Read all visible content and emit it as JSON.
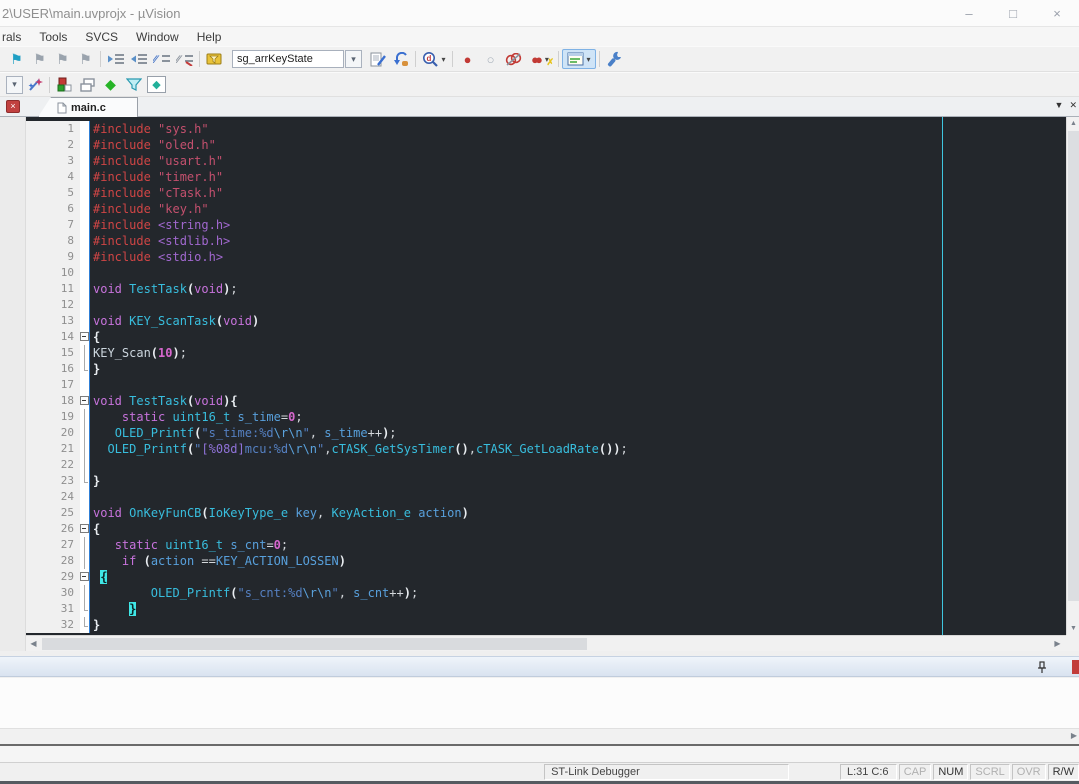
{
  "window": {
    "title": "2\\USER\\main.uvprojx - µVision",
    "minimize": "–",
    "maximize": "□",
    "close": "×"
  },
  "menu": {
    "items": [
      "rals",
      "Tools",
      "SVCS",
      "Window",
      "Help"
    ]
  },
  "toolbar_main": {
    "symbol_combo_value": "sg_arrKeyState",
    "icons": [
      "insert-bookmark",
      "previous-bookmark",
      "next-bookmark",
      "clear-all-bookmarks",
      "unindent",
      "indent",
      "comment-selection",
      "uncomment-selection",
      "find-in-files",
      "symbol-combo",
      "configure-flash-tools",
      "jump-back",
      "find-dialog",
      "toggle-breakpoint",
      "disable-breakpoint",
      "disable-all-breakpoints",
      "kill-all-breakpoints",
      "debug-windows",
      "configure-tools"
    ]
  },
  "toolbar_debug": {
    "icons": [
      "window-select-dropdown",
      "wizard",
      "command-window",
      "disassembly-window",
      "symbols-window",
      "watch-window",
      "memory-window"
    ]
  },
  "tabs": {
    "active": "main.c"
  },
  "editor": {
    "language": "c",
    "lines": [
      {
        "n": "1",
        "fold": "none",
        "t": [
          [
            "pp",
            "#include"
          ],
          [
            "pl",
            " "
          ],
          [
            "inc",
            "\"sys.h\""
          ]
        ]
      },
      {
        "n": "2",
        "fold": "none",
        "t": [
          [
            "pp",
            "#include"
          ],
          [
            "pl",
            " "
          ],
          [
            "inc",
            "\"oled.h\""
          ]
        ]
      },
      {
        "n": "3",
        "fold": "none",
        "t": [
          [
            "pp",
            "#include"
          ],
          [
            "pl",
            " "
          ],
          [
            "inc",
            "\"usart.h\""
          ]
        ]
      },
      {
        "n": "4",
        "fold": "none",
        "t": [
          [
            "pp",
            "#include"
          ],
          [
            "pl",
            " "
          ],
          [
            "inc",
            "\"timer.h\""
          ]
        ]
      },
      {
        "n": "5",
        "fold": "none",
        "t": [
          [
            "pp",
            "#include"
          ],
          [
            "pl",
            " "
          ],
          [
            "inc",
            "\"cTask.h\""
          ]
        ]
      },
      {
        "n": "6",
        "fold": "none",
        "t": [
          [
            "pp",
            "#include"
          ],
          [
            "pl",
            " "
          ],
          [
            "inc",
            "\"key.h\""
          ]
        ]
      },
      {
        "n": "7",
        "fold": "none",
        "t": [
          [
            "pp",
            "#include"
          ],
          [
            "pl",
            " "
          ],
          [
            "incs",
            "<string.h>"
          ]
        ]
      },
      {
        "n": "8",
        "fold": "none",
        "t": [
          [
            "pp",
            "#include"
          ],
          [
            "pl",
            " "
          ],
          [
            "incs",
            "<stdlib.h>"
          ]
        ]
      },
      {
        "n": "9",
        "fold": "none",
        "t": [
          [
            "pp",
            "#include"
          ],
          [
            "pl",
            " "
          ],
          [
            "incs",
            "<stdio.h>"
          ]
        ]
      },
      {
        "n": "10",
        "fold": "none",
        "t": []
      },
      {
        "n": "11",
        "fold": "none",
        "t": [
          [
            "kw",
            "void"
          ],
          [
            "pl",
            " "
          ],
          [
            "cy",
            "TestTask"
          ],
          [
            "br",
            "("
          ],
          [
            "kw",
            "void"
          ],
          [
            "br",
            ")"
          ],
          [
            "pun",
            ";"
          ]
        ]
      },
      {
        "n": "12",
        "fold": "none",
        "t": []
      },
      {
        "n": "13",
        "fold": "none",
        "t": [
          [
            "kw",
            "void"
          ],
          [
            "pl",
            " "
          ],
          [
            "cy",
            "KEY_ScanTask"
          ],
          [
            "br",
            "("
          ],
          [
            "kw",
            "void"
          ],
          [
            "br",
            ")"
          ]
        ]
      },
      {
        "n": "14",
        "fold": "box",
        "t": [
          [
            "br",
            "{"
          ]
        ]
      },
      {
        "n": "15",
        "fold": "line",
        "t": [
          [
            "pl2",
            "KEY_Scan"
          ],
          [
            "br",
            "("
          ],
          [
            "num",
            "10"
          ],
          [
            "br",
            ")"
          ],
          [
            "pun",
            ";"
          ]
        ]
      },
      {
        "n": "16",
        "fold": "end",
        "t": [
          [
            "br",
            "}"
          ]
        ]
      },
      {
        "n": "17",
        "fold": "none",
        "t": []
      },
      {
        "n": "18",
        "fold": "box",
        "t": [
          [
            "kw",
            "void"
          ],
          [
            "pl",
            " "
          ],
          [
            "cy",
            "TestTask"
          ],
          [
            "br",
            "("
          ],
          [
            "kw",
            "void"
          ],
          [
            "br",
            ")"
          ],
          [
            "br",
            "{"
          ]
        ]
      },
      {
        "n": "19",
        "fold": "line",
        "t": [
          [
            "pl",
            "    "
          ],
          [
            "kw",
            "static"
          ],
          [
            "pl",
            " "
          ],
          [
            "cy",
            "uint16_t"
          ],
          [
            "pl",
            " "
          ],
          [
            "var",
            "s_time"
          ],
          [
            "pun",
            "="
          ],
          [
            "num",
            "0"
          ],
          [
            "pun",
            ";"
          ]
        ]
      },
      {
        "n": "20",
        "fold": "line",
        "t": [
          [
            "pl",
            "   "
          ],
          [
            "cy",
            "OLED_Printf"
          ],
          [
            "br",
            "("
          ],
          [
            "str",
            "\"s_time:%d"
          ],
          [
            "esc",
            "\\r\\n"
          ],
          [
            "str",
            "\""
          ],
          [
            "pun",
            ", "
          ],
          [
            "var",
            "s_time"
          ],
          [
            "pun",
            "++"
          ],
          [
            "br",
            ")"
          ],
          [
            "pun",
            ";"
          ]
        ]
      },
      {
        "n": "21",
        "fold": "line",
        "t": [
          [
            "pl",
            "  "
          ],
          [
            "cy",
            "OLED_Printf"
          ],
          [
            "br",
            "("
          ],
          [
            "str",
            "\""
          ],
          [
            "fmt",
            "[%08d]"
          ],
          [
            "str",
            "mcu:%d"
          ],
          [
            "esc",
            "\\r\\n"
          ],
          [
            "str",
            "\""
          ],
          [
            "pun",
            ","
          ],
          [
            "cy",
            "cTASK_GetSysTimer"
          ],
          [
            "br",
            "()"
          ],
          [
            "pun",
            ","
          ],
          [
            "cy",
            "cTASK_GetLoadRate"
          ],
          [
            "br",
            "()"
          ],
          [
            "br",
            ")"
          ],
          [
            "pun",
            ";"
          ]
        ]
      },
      {
        "n": "22",
        "fold": "line",
        "t": []
      },
      {
        "n": "23",
        "fold": "end",
        "t": [
          [
            "br",
            "}"
          ]
        ]
      },
      {
        "n": "24",
        "fold": "none",
        "t": []
      },
      {
        "n": "25",
        "fold": "none",
        "t": [
          [
            "kw",
            "void"
          ],
          [
            "pl",
            " "
          ],
          [
            "cy",
            "OnKeyFunCB"
          ],
          [
            "br",
            "("
          ],
          [
            "cy",
            "IoKeyType_e"
          ],
          [
            "pl",
            " "
          ],
          [
            "var",
            "key"
          ],
          [
            "pun",
            ", "
          ],
          [
            "cy",
            "KeyAction_e"
          ],
          [
            "pl",
            " "
          ],
          [
            "var",
            "action"
          ],
          [
            "br",
            ")"
          ]
        ]
      },
      {
        "n": "26",
        "fold": "box",
        "t": [
          [
            "br",
            "{"
          ]
        ]
      },
      {
        "n": "27",
        "fold": "line",
        "t": [
          [
            "pl",
            "   "
          ],
          [
            "kw",
            "static"
          ],
          [
            "pl",
            " "
          ],
          [
            "cy",
            "uint16_t"
          ],
          [
            "pl",
            " "
          ],
          [
            "var",
            "s_cnt"
          ],
          [
            "pun",
            "="
          ],
          [
            "num",
            "0"
          ],
          [
            "pun",
            ";"
          ]
        ]
      },
      {
        "n": "28",
        "fold": "line",
        "t": [
          [
            "pl",
            "    "
          ],
          [
            "kw",
            "if"
          ],
          [
            "pl",
            " "
          ],
          [
            "br",
            "("
          ],
          [
            "var",
            "action"
          ],
          [
            "pl",
            " "
          ],
          [
            "pun",
            "=="
          ],
          [
            "var",
            "KEY_ACTION_LOSSEN"
          ],
          [
            "br",
            ")"
          ]
        ]
      },
      {
        "n": "29",
        "fold": "box",
        "t": [
          [
            "pl",
            " "
          ],
          [
            "match",
            "{"
          ]
        ]
      },
      {
        "n": "30",
        "fold": "line",
        "t": [
          [
            "pl",
            "        "
          ],
          [
            "cy",
            "OLED_Printf"
          ],
          [
            "br",
            "("
          ],
          [
            "str",
            "\"s_cnt:%d"
          ],
          [
            "esc",
            "\\r\\n"
          ],
          [
            "str",
            "\""
          ],
          [
            "pun",
            ", "
          ],
          [
            "var",
            "s_cnt"
          ],
          [
            "pun",
            "++"
          ],
          [
            "br",
            ")"
          ],
          [
            "pun",
            ";"
          ]
        ]
      },
      {
        "n": "31",
        "fold": "end",
        "t": [
          [
            "pl",
            "     "
          ],
          [
            "match",
            "}"
          ]
        ]
      },
      {
        "n": "32",
        "fold": "end",
        "t": [
          [
            "br",
            "}"
          ]
        ]
      }
    ],
    "colors": {
      "background": "#23272c",
      "ruler": "#3fc6df",
      "preprocessor": "#cf4545",
      "keyword": "#c873dd",
      "identifier_cyan": "#38bede",
      "variable": "#58a0dc",
      "string": "#5580c2",
      "number": "#d667cd",
      "brace_match_bg": "#3fe6e6"
    }
  },
  "statusbar": {
    "debugger": "ST-Link Debugger",
    "cursor": "L:31 C:6",
    "flags": [
      {
        "label": "CAP",
        "active": false
      },
      {
        "label": "NUM",
        "active": true
      },
      {
        "label": "SCRL",
        "active": false
      },
      {
        "label": "OVR",
        "active": false
      },
      {
        "label": "R/W",
        "active": true
      }
    ]
  }
}
